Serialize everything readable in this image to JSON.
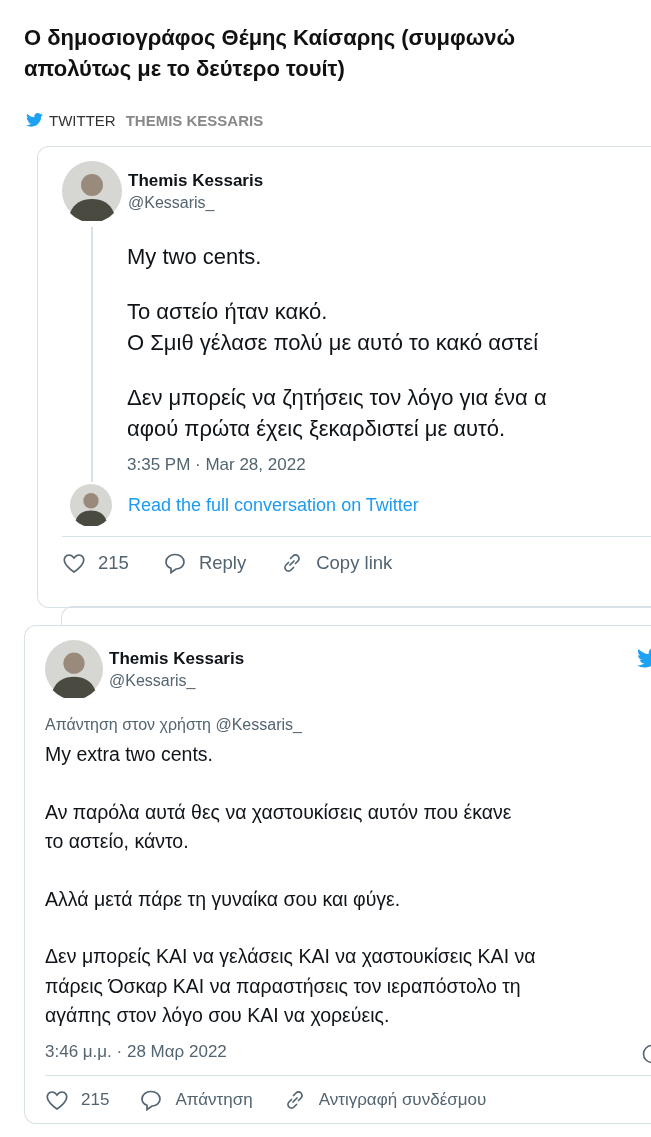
{
  "article": {
    "headline": "Ο δημοσιογράφος Θέμης Καίσαρης (συμφωνώ απολύτως με το δεύτερο τουίτ)"
  },
  "source": {
    "site": "TWITTER",
    "author": "THEMIS KESSARIS"
  },
  "tweets": [
    {
      "kind": "thread",
      "name": "Themis Kessaris",
      "handle": "@Kessaris_",
      "paragraphs": [
        [
          "My two cents."
        ],
        [
          "Το αστείο ήταν κακό.",
          "Ο Σμιθ γέλασε πολύ με αυτό το κακό αστεί"
        ],
        [
          "Δεν μπορείς να ζητήσεις τον λόγο για ένα α",
          "αφού πρώτα έχεις ξεκαρδιστεί με αυτό."
        ]
      ],
      "timestamp": "3:35 PM · Mar 28, 2022",
      "read_more": "Read the full conversation on Twitter",
      "likes": "215",
      "reply": "Reply",
      "copy": "Copy link"
    },
    {
      "kind": "single",
      "name": "Themis Kessaris",
      "handle": "@Kessaris_",
      "reply_to": "Απάντηση στον χρήστη @Kessaris_",
      "paragraphs": [
        [
          "My extra two cents."
        ],
        [
          "Αν παρόλα αυτά θες να χαστουκίσεις αυτόν που έκανε",
          "το αστείο, κάντο."
        ],
        [
          "Αλλά μετά πάρε τη γυναίκα σου και φύγε."
        ],
        [
          "Δεν μπορείς ΚΑΙ να γελάσεις ΚΑΙ να χαστουκίσεις ΚΑΙ να",
          "πάρεις Όσκαρ ΚΑΙ να παραστήσεις τον ιεραπόστολο τη",
          "αγάπης στον λόγο σου ΚΑΙ να χορεύεις."
        ]
      ],
      "timestamp": "3:46 μ.μ. · 28 Μαρ 2022",
      "likes": "215",
      "reply": "Απάντηση",
      "copy": "Αντιγραφή συνδέσμου"
    }
  ]
}
